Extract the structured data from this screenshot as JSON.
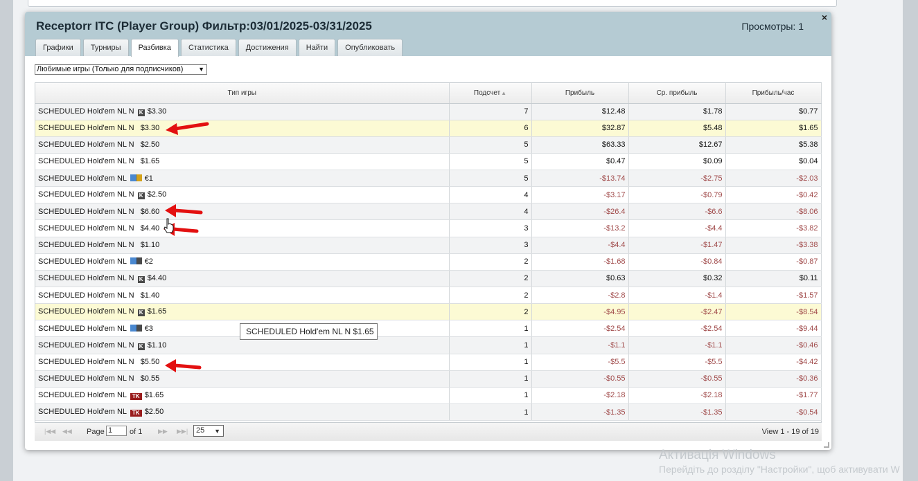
{
  "window": {
    "title": "Receptorr ITC (Player Group) Фильтр:03/01/2025-03/31/2025",
    "views": "Просмотры: 1",
    "close_glyph": "×"
  },
  "tabs": [
    {
      "label": "Графики",
      "active": false
    },
    {
      "label": "Турниры",
      "active": false
    },
    {
      "label": "Разбивка",
      "active": true
    },
    {
      "label": "Статистика",
      "active": false
    },
    {
      "label": "Достижения",
      "active": false
    },
    {
      "label": "Найти",
      "active": false
    },
    {
      "label": "Опубликовать",
      "active": false
    }
  ],
  "filter": {
    "selected": "Любимые игры (Только для подписчиков)"
  },
  "table": {
    "columns": [
      "Тип игры",
      "Подсчет",
      "Прибыль",
      "Ср. прибыль",
      "Прибыль/час"
    ],
    "rows": [
      {
        "game": "SCHEDULED Hold'em NL N",
        "icon": "k-icon",
        "stake": "$3.30",
        "count": "7",
        "profit": "$12.48",
        "avg": "$1.78",
        "hour": "$0.77"
      },
      {
        "game": "SCHEDULED Hold'em NL N",
        "icon": "",
        "stake": "$3.30",
        "count": "6",
        "profit": "$32.87",
        "avg": "$5.48",
        "hour": "$1.65"
      },
      {
        "game": "SCHEDULED Hold'em NL N",
        "icon": "",
        "stake": "$2.50",
        "count": "5",
        "profit": "$63.33",
        "avg": "$12.67",
        "hour": "$5.38"
      },
      {
        "game": "SCHEDULED Hold'em NL N",
        "icon": "",
        "stake": "$1.65",
        "count": "5",
        "profit": "$0.47",
        "avg": "$0.09",
        "hour": "$0.04"
      },
      {
        "game": "SCHEDULED Hold'em NL",
        "icon": "bounty-plus-icon",
        "stake": "€1",
        "count": "5",
        "profit": "-$13.74",
        "avg": "-$2.75",
        "hour": "-$2.03"
      },
      {
        "game": "SCHEDULED Hold'em NL N",
        "icon": "k-icon",
        "stake": "$2.50",
        "count": "4",
        "profit": "-$3.17",
        "avg": "-$0.79",
        "hour": "-$0.42"
      },
      {
        "game": "SCHEDULED Hold'em NL N",
        "icon": "",
        "stake": "$6.60",
        "count": "4",
        "profit": "-$26.4",
        "avg": "-$6.6",
        "hour": "-$8.06"
      },
      {
        "game": "SCHEDULED Hold'em NL N",
        "icon": "",
        "stake": "$4.40",
        "count": "3",
        "profit": "-$13.2",
        "avg": "-$4.4",
        "hour": "-$3.82"
      },
      {
        "game": "SCHEDULED Hold'em NL N",
        "icon": "",
        "stake": "$1.10",
        "count": "3",
        "profit": "-$4.4",
        "avg": "-$1.47",
        "hour": "-$3.38"
      },
      {
        "game": "SCHEDULED Hold'em NL",
        "icon": "bounty-k-icon",
        "stake": "€2",
        "count": "2",
        "profit": "-$1.68",
        "avg": "-$0.84",
        "hour": "-$0.87"
      },
      {
        "game": "SCHEDULED Hold'em NL N",
        "icon": "k-icon",
        "stake": "$4.40",
        "count": "2",
        "profit": "$0.63",
        "avg": "$0.32",
        "hour": "$0.11"
      },
      {
        "game": "SCHEDULED Hold'em NL N",
        "icon": "",
        "stake": "$1.40",
        "count": "2",
        "profit": "-$2.8",
        "avg": "-$1.4",
        "hour": "-$1.57"
      },
      {
        "game": "SCHEDULED Hold'em NL N",
        "icon": "k-icon",
        "stake": "$1.65",
        "count": "2",
        "profit": "-$4.95",
        "avg": "-$2.47",
        "hour": "-$8.54"
      },
      {
        "game": "SCHEDULED Hold'em NL",
        "icon": "bounty-k-icon",
        "stake": "€3",
        "count": "1",
        "profit": "-$2.54",
        "avg": "-$2.54",
        "hour": "-$9.44"
      },
      {
        "game": "SCHEDULED Hold'em NL N",
        "icon": "k-icon",
        "stake": "$1.10",
        "count": "1",
        "profit": "-$1.1",
        "avg": "-$1.1",
        "hour": "-$0.46"
      },
      {
        "game": "SCHEDULED Hold'em NL N",
        "icon": "",
        "stake": "$5.50",
        "count": "1",
        "profit": "-$5.5",
        "avg": "-$5.5",
        "hour": "-$4.42"
      },
      {
        "game": "SCHEDULED Hold'em NL N",
        "icon": "",
        "stake": "$0.55",
        "count": "1",
        "profit": "-$0.55",
        "avg": "-$0.55",
        "hour": "-$0.36"
      },
      {
        "game": "SCHEDULED Hold'em NL",
        "icon": "tk-icon",
        "stake": "$1.65",
        "count": "1",
        "profit": "-$2.18",
        "avg": "-$2.18",
        "hour": "-$1.77"
      },
      {
        "game": "SCHEDULED Hold'em NL",
        "icon": "tk-icon",
        "stake": "$2.50",
        "count": "1",
        "profit": "-$1.35",
        "avg": "-$1.35",
        "hour": "-$0.54"
      }
    ]
  },
  "pager": {
    "page_label": "Page",
    "page_value": "1",
    "of_label": "of 1",
    "page_size": "25",
    "view_text": "View 1 - 19 of 19"
  },
  "tooltip": "SCHEDULED Hold'em NL N   $1.65",
  "watermark": {
    "line1": "Активація Windows",
    "line2": "Перейдіть до розділу \"Настройки\", щоб активувати W"
  },
  "colors": {
    "header_bg": "#b5cbd3",
    "negative": "#a04a4a",
    "highlight_row": "#fcfad4",
    "annotation_arrow": "#e31010"
  }
}
